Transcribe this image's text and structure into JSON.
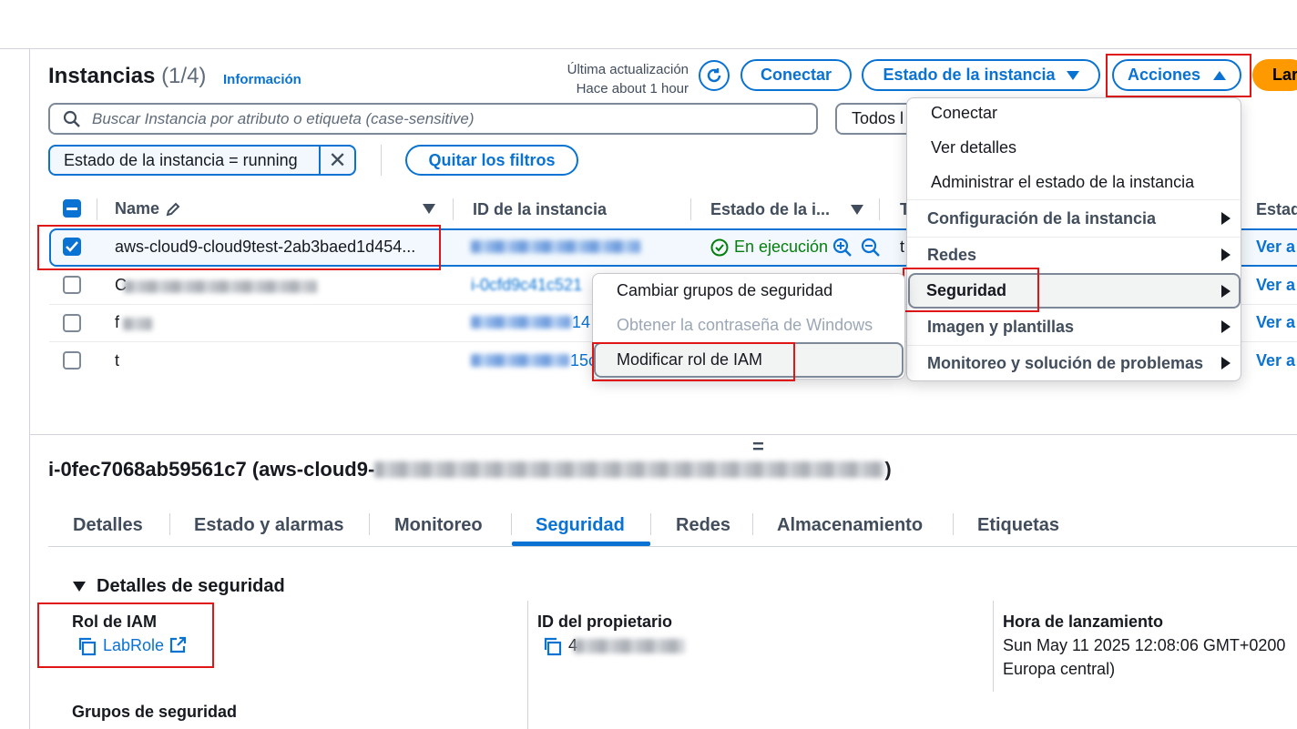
{
  "header": {
    "title": "Instancias",
    "count": "(1/4)",
    "info_link": "Información",
    "last_update_label": "Última actualización",
    "last_update_value": "Hace about 1 hour",
    "connect_label": "Conectar",
    "instance_state_label": "Estado de la instancia",
    "actions_label": "Acciones",
    "launch_label": "Lar"
  },
  "search": {
    "placeholder": "Buscar Instancia por atributo o etiqueta (case-sensitive)",
    "scope_select": "Todos l"
  },
  "filter": {
    "token": "Estado de la instancia = running",
    "clear_label": "Quitar los filtros"
  },
  "table": {
    "col_name": "Name",
    "col_id": "ID de la instancia",
    "col_state": "Estado de la i...",
    "col_type": "T",
    "col_status": "Estad",
    "rows": [
      {
        "name": "aws-cloud9-cloud9test-2ab3baed1d454...",
        "id": "i-0fec7068ab59561c7",
        "state": "En ejecución",
        "type": "t",
        "link": "Ver a",
        "selected": true
      },
      {
        "name": "C",
        "id": "i-0cfd9c41c521",
        "link": "Ver a",
        "selected": false
      },
      {
        "name": "f",
        "id": "14",
        "link": "Ver a",
        "selected": false
      },
      {
        "name": "t",
        "id": "15c",
        "link": "Ver a",
        "selected": false
      }
    ]
  },
  "actions_menu": {
    "items": [
      "Conectar",
      "Ver detalles",
      "Administrar el estado de la instancia"
    ],
    "groups": [
      "Configuración de la instancia",
      "Redes",
      "Seguridad",
      "Imagen y plantillas",
      "Monitoreo y solución de problemas"
    ]
  },
  "security_submenu": {
    "items": [
      "Cambiar grupos de seguridad",
      "Obtener la contraseña de Windows",
      "Modificar rol de IAM"
    ]
  },
  "details": {
    "drag_handle": "=",
    "instance_title": "i-0fec7068ab59561c7 (aws-cloud9-",
    "instance_title_end": ")",
    "tabs": [
      "Detalles",
      "Estado y alarmas",
      "Monitoreo",
      "Seguridad",
      "Redes",
      "Almacenamiento",
      "Etiquetas"
    ],
    "section_title": "Detalles de seguridad",
    "iam_role_label": "Rol de IAM",
    "iam_role_value": "LabRole",
    "owner_label": "ID del propietario",
    "owner_value": "4",
    "launch_time_label": "Hora de lanzamiento",
    "launch_time_value": "Sun May 11 2025 12:08:06 GMT+0200",
    "launch_time_tz": "Europa central)",
    "security_groups_label": "Grupos de seguridad"
  },
  "colors": {
    "accent": "#0972d3",
    "highlight": "#e01515",
    "success": "#037f0c",
    "launch_orange": "#ff9900"
  }
}
